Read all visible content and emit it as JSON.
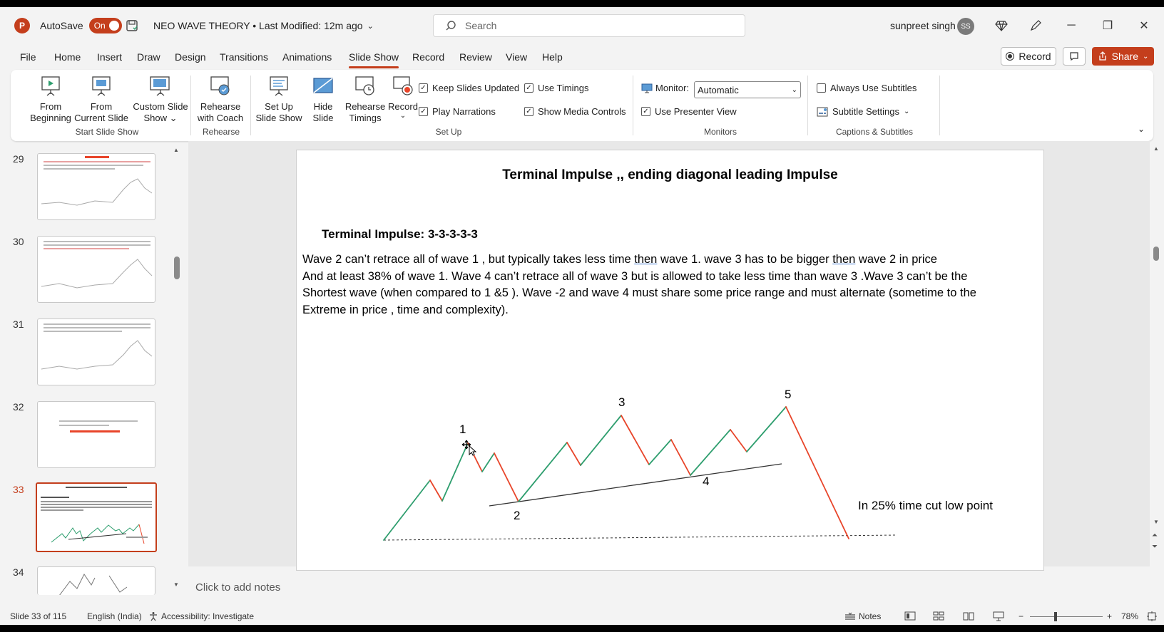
{
  "titlebar": {
    "autosave_label": "AutoSave",
    "autosave_state": "On",
    "doc_title": "NEO WAVE THEORY • Last Modified: 12m ago",
    "search_placeholder": "Search",
    "user_name": "sunpreet singh",
    "user_initials": "SS"
  },
  "menu": {
    "tabs": [
      "File",
      "Home",
      "Insert",
      "Draw",
      "Design",
      "Transitions",
      "Animations",
      "Slide Show",
      "Record",
      "Review",
      "View",
      "Help"
    ],
    "active": "Slide Show",
    "record_label": "Record",
    "share_label": "Share"
  },
  "ribbon": {
    "from_beginning": [
      "From",
      "Beginning"
    ],
    "from_current": [
      "From",
      "Current Slide"
    ],
    "custom_show": [
      "Custom Slide",
      "Show ⌄"
    ],
    "group_start": "Start Slide Show",
    "rehearse_coach": [
      "Rehearse",
      "with Coach"
    ],
    "group_rehearse": "Rehearse",
    "setup_show": [
      "Set Up",
      "Slide Show"
    ],
    "hide_slide": [
      "Hide",
      "Slide"
    ],
    "rehearse_timings": [
      "Rehearse",
      "Timings"
    ],
    "record": "Record",
    "keep_updated": "Keep Slides Updated",
    "use_timings": "Use Timings",
    "play_narrations": "Play Narrations",
    "show_media": "Show Media Controls",
    "group_setup": "Set Up",
    "monitor_label": "Monitor:",
    "monitor_value": "Automatic",
    "presenter_view": "Use Presenter View",
    "group_monitors": "Monitors",
    "always_subtitles": "Always Use Subtitles",
    "subtitle_settings": "Subtitle Settings",
    "group_captions": "Captions & Subtitles"
  },
  "thumbnails": {
    "numbers": [
      "29",
      "30",
      "31",
      "32",
      "33",
      "34"
    ],
    "active": "33"
  },
  "slide": {
    "title": "Terminal Impulse ,, ending diagonal leading Impulse",
    "subtitle": "Terminal Impulse: 3-3-3-3-3",
    "line1_a": "Wave 2 can’t retrace all of wave 1 , but typically takes less time ",
    "line1_then1": "then",
    "line1_b": " wave 1.  wave 3 has  to be bigger ",
    "line1_then2": "then",
    "line1_c": " wave 2 in price",
    "line2": "And at least 38% of wave 1.  Wave 4 can’t retrace all of wave 3 but is allowed to take less time than wave 3 .Wave 3 can’t be the",
    "line3": "Shortest wave (when compared to 1 &5 ). Wave -2 and wave 4 must share some price range and must alternate (sometime to the",
    "line4": "Extreme in price , time and complexity).",
    "wave_labels": [
      "1",
      "2",
      "3",
      "4",
      "5"
    ],
    "annotation": "In 25% time cut low point",
    "up_color": "#2e9e6e",
    "down_color": "#e8452a"
  },
  "notes_placeholder": "Click to add notes",
  "status": {
    "slide_count": "Slide 33 of 115",
    "language": "English (India)",
    "accessibility": "Accessibility: Investigate",
    "notes": "Notes",
    "zoom": "78%"
  }
}
